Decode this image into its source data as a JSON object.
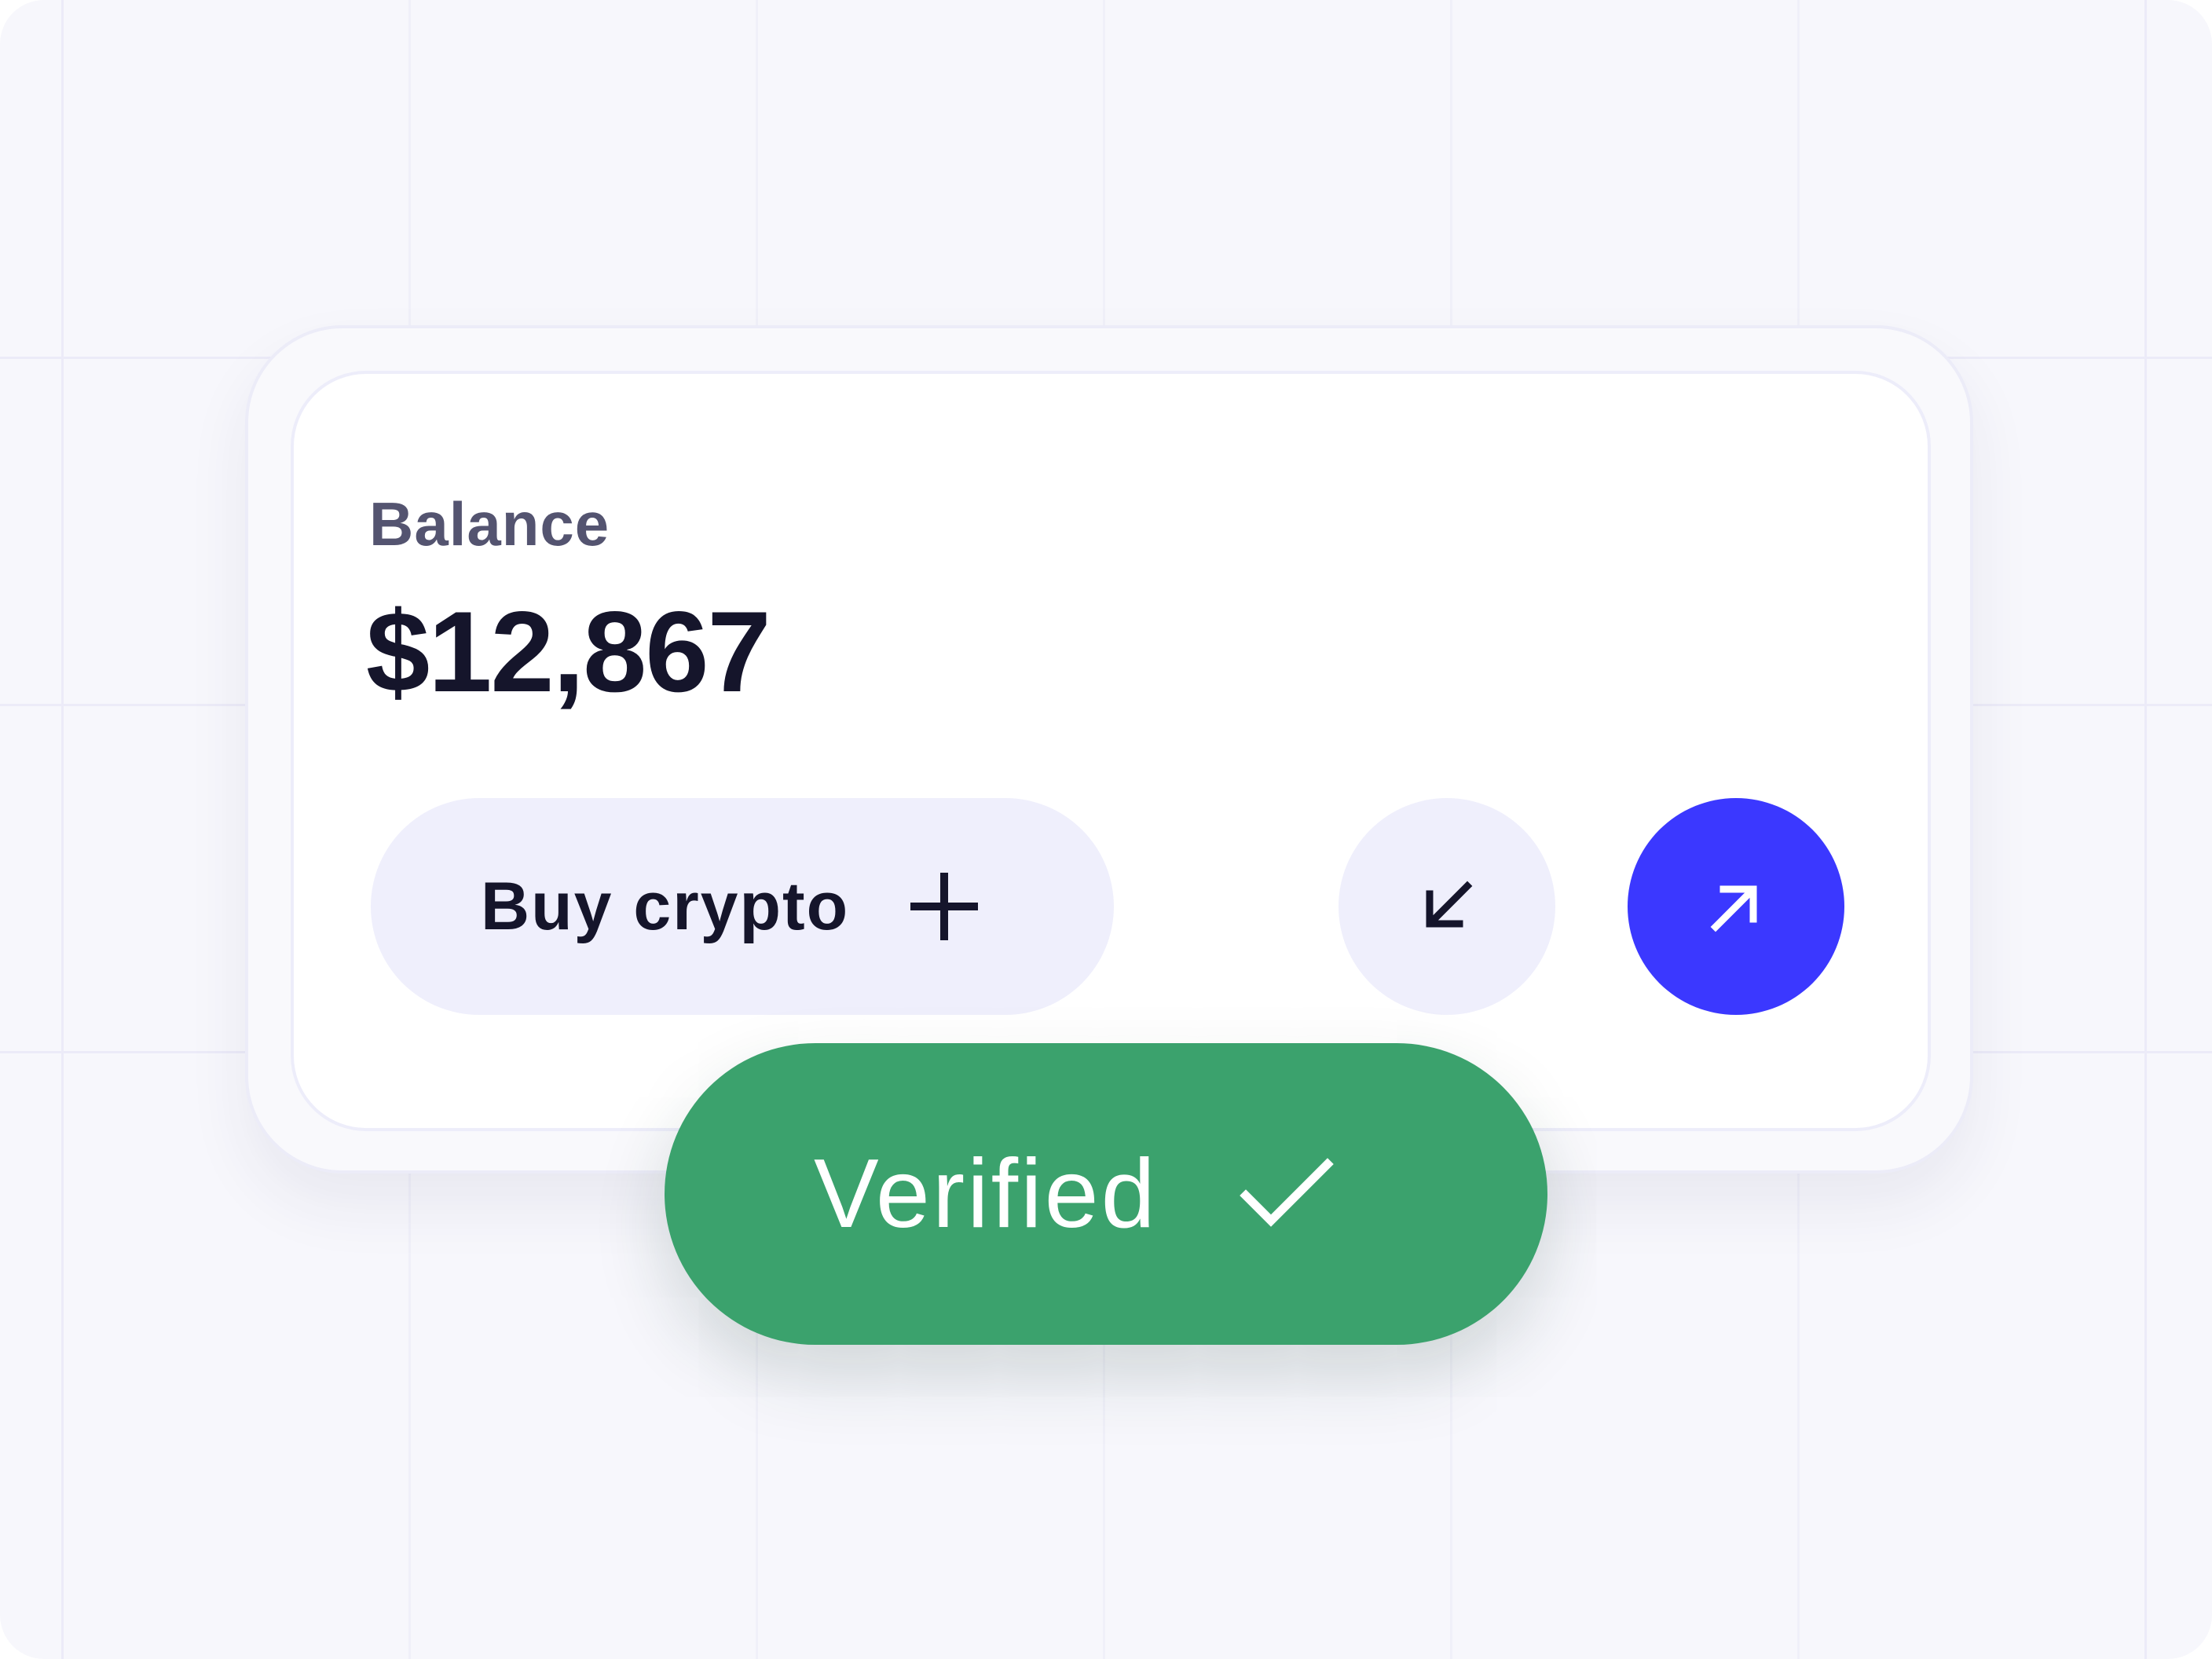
{
  "balance": {
    "label": "Balance",
    "value": "$12,867"
  },
  "actions": {
    "buy_label": "Buy crypto",
    "buy_icon": "plus-icon",
    "receive_icon": "arrow-down-left-icon",
    "send_icon": "arrow-up-right-icon"
  },
  "status": {
    "label": "Verified",
    "icon": "check-icon"
  },
  "colors": {
    "background": "#f7f7fc",
    "card": "#ffffff",
    "text_primary": "#15152b",
    "text_secondary": "#545470",
    "secondary_button": "#efeffc",
    "primary_button": "#3b38ff",
    "verified": "#3ba26d"
  }
}
